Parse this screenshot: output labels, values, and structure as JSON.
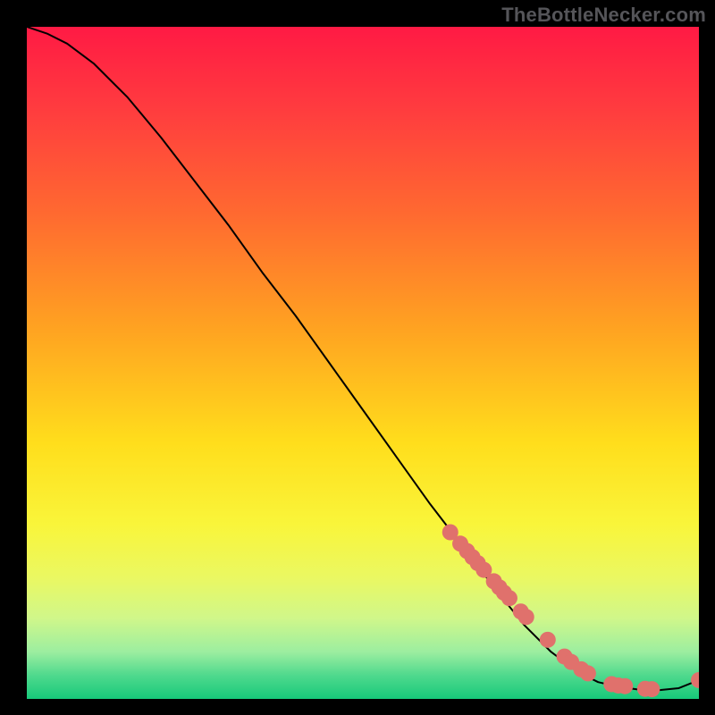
{
  "watermark": "TheBottleNecker.com",
  "chart_data": {
    "type": "line",
    "title": "",
    "xlabel": "",
    "ylabel": "",
    "xlim": [
      0,
      100
    ],
    "ylim": [
      0,
      100
    ],
    "grid": false,
    "background_gradient": {
      "stops": [
        {
          "offset": 0.0,
          "color": "#ff1a44"
        },
        {
          "offset": 0.12,
          "color": "#ff3b3f"
        },
        {
          "offset": 0.28,
          "color": "#ff6a30"
        },
        {
          "offset": 0.45,
          "color": "#ffa321"
        },
        {
          "offset": 0.62,
          "color": "#ffde1c"
        },
        {
          "offset": 0.74,
          "color": "#f9f53a"
        },
        {
          "offset": 0.82,
          "color": "#eaf862"
        },
        {
          "offset": 0.88,
          "color": "#d0f78a"
        },
        {
          "offset": 0.93,
          "color": "#9ceea0"
        },
        {
          "offset": 0.965,
          "color": "#4fd98d"
        },
        {
          "offset": 1.0,
          "color": "#17c97a"
        }
      ]
    },
    "series": [
      {
        "name": "bottleneck-curve",
        "color": "#000000",
        "stroke_width": 2,
        "x": [
          0,
          3,
          6,
          10,
          15,
          20,
          25,
          30,
          35,
          40,
          45,
          50,
          55,
          60,
          65,
          70,
          74,
          78,
          82,
          85,
          88,
          91,
          94,
          97,
          100
        ],
        "y": [
          100,
          99,
          97.5,
          94.5,
          89.5,
          83.5,
          77,
          70.5,
          63.5,
          57,
          50,
          43,
          36,
          29,
          22.5,
          16,
          11,
          7,
          4,
          2.5,
          1.8,
          1.4,
          1.3,
          1.6,
          2.8
        ]
      }
    ],
    "points": [
      {
        "name": "data-cluster",
        "color": "#e0716c",
        "radius": 9,
        "x": [
          63,
          64.5,
          65.5,
          66.3,
          67.1,
          68,
          69.5,
          70.3,
          71.0,
          71.8,
          73.5,
          74.3,
          77.5,
          80.0,
          81.0,
          82.5,
          83.5,
          87.0,
          88.0,
          89.0,
          92.0,
          93.0,
          100
        ],
        "y": [
          24.8,
          23.1,
          22.0,
          21.1,
          20.2,
          19.2,
          17.5,
          16.6,
          15.8,
          15.0,
          13.0,
          12.2,
          8.8,
          6.3,
          5.5,
          4.4,
          3.8,
          2.2,
          2.0,
          1.9,
          1.5,
          1.45,
          2.8
        ]
      }
    ]
  }
}
